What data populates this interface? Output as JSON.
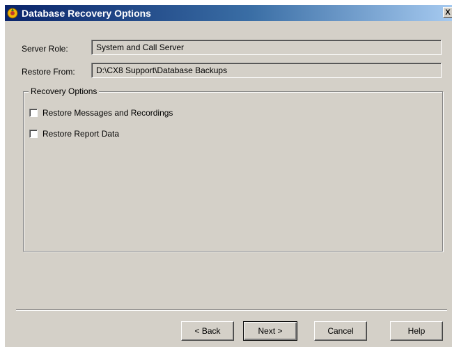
{
  "window": {
    "title": "Database Recovery Options",
    "close_glyph": "X"
  },
  "fields": {
    "server_role": {
      "label": "Server Role:",
      "value": "System and Call Server"
    },
    "restore_from": {
      "label": "Restore From:",
      "value": "D:\\CX8 Support\\Database  Backups"
    }
  },
  "recovery_options": {
    "legend": "Recovery Options",
    "items": [
      {
        "label": "Restore Messages and Recordings",
        "checked": false
      },
      {
        "label": "Restore Report Data",
        "checked": false
      }
    ]
  },
  "buttons": {
    "back": "< Back",
    "next": "Next >",
    "cancel": "Cancel",
    "help": "Help"
  },
  "icons": {
    "app": "database-recovery-icon",
    "close": "close-icon"
  },
  "colors": {
    "titlebar_start": "#0a246a",
    "titlebar_end": "#a6caf0",
    "face": "#d4d0c8"
  }
}
